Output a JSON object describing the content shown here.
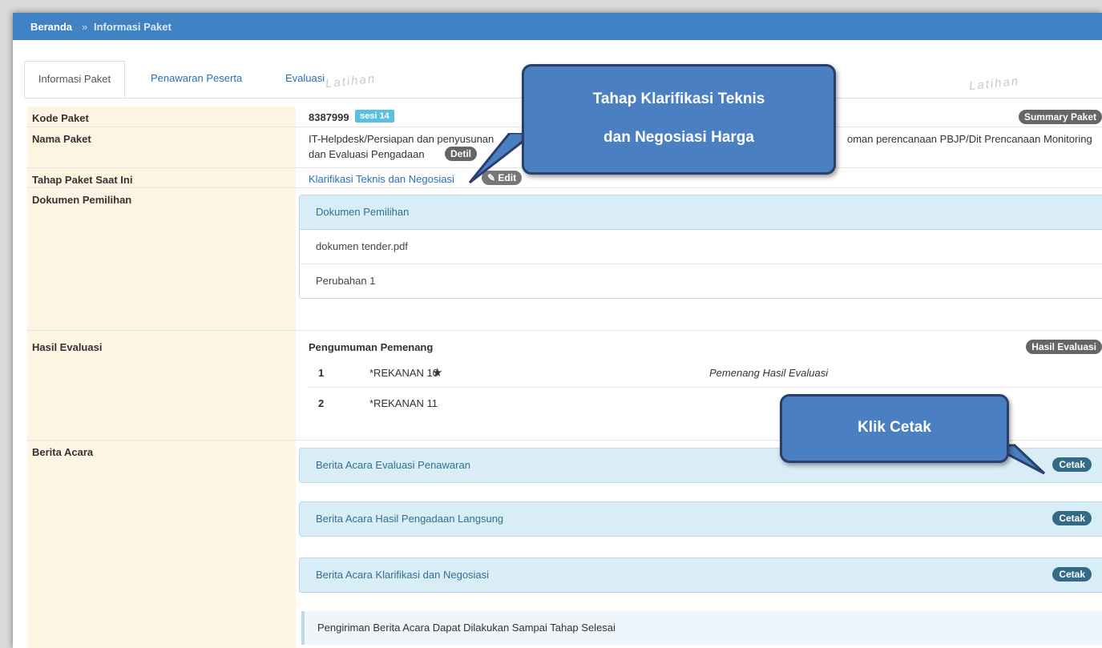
{
  "breadcrumb": {
    "home": "Beranda",
    "separator": "»",
    "current": "Informasi Paket"
  },
  "tabs": [
    {
      "label": "Informasi Paket"
    },
    {
      "label": "Penawaran Peserta"
    },
    {
      "label": "Evaluasi"
    }
  ],
  "watermark": "Latihan",
  "rows": {
    "kode": {
      "label": "Kode Paket",
      "value": "8387999",
      "sesi": "sesi 14",
      "summary_button": "Summary Paket"
    },
    "nama": {
      "label": "Nama Paket",
      "line1_start": "IT-Helpdesk/Persiapan dan penyusunan",
      "line1_end": "oman perencanaan PBJP/Dit Prencanaan Monitoring",
      "line2": "dan Evaluasi Pengadaan",
      "detil_button": "Detil"
    },
    "tahap": {
      "label": "Tahap Paket Saat Ini",
      "value": "Klarifikasi Teknis dan Negosiasi",
      "edit_button": "Edit"
    },
    "dokumen": {
      "label": "Dokumen Pemilihan",
      "panel_title": "Dokumen Pemilihan",
      "items": [
        "dokumen tender.pdf",
        "Perubahan 1"
      ]
    },
    "hasil": {
      "label": "Hasil Evaluasi",
      "heading": "Pengumuman Pemenang",
      "button": "Hasil Evaluasi",
      "winners": [
        {
          "no": "1",
          "name": "*REKANAN 10",
          "star": "★",
          "note": "Pemenang Hasil Evaluasi"
        },
        {
          "no": "2",
          "name": "*REKANAN 11",
          "star": "",
          "note": ""
        }
      ]
    },
    "berita": {
      "label": "Berita Acara",
      "items": [
        {
          "title": "Berita Acara Evaluasi Penawaran",
          "button": "Cetak"
        },
        {
          "title": "Berita Acara Hasil Pengadaan Langsung",
          "button": "Cetak"
        },
        {
          "title": "Berita Acara Klarifikasi dan Negosiasi",
          "button": "Cetak"
        }
      ],
      "note": "Pengiriman Berita Acara Dapat Dilakukan Sampai Tahap Selesai"
    }
  },
  "callouts": {
    "tahap": {
      "line1": "Tahap Klarifikasi Teknis",
      "line2": "dan Negosiasi Harga"
    },
    "cetak": {
      "text": "Klik Cetak"
    }
  },
  "colors": {
    "topbar": "#3f83c4",
    "label_bg": "#fdf5e1",
    "panel_bg": "#d9edf7",
    "callout": "#4a7fc1",
    "cetak": "#336b87"
  }
}
